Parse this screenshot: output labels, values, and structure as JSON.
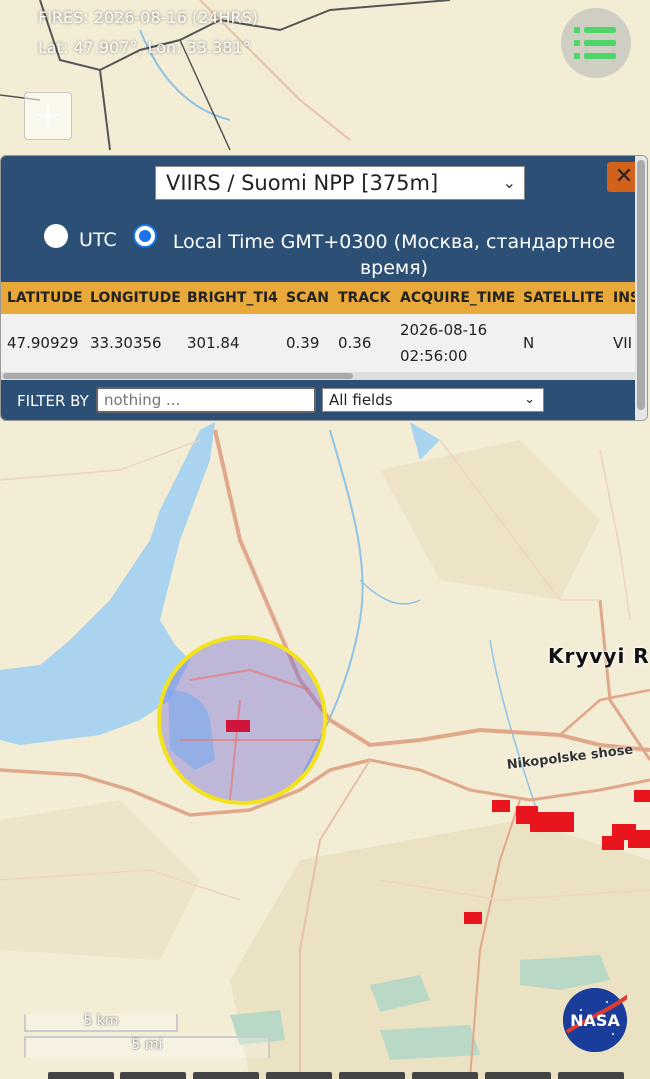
{
  "header": {
    "fires_title": "FIRES: 2026-08-16 (24HRS)",
    "coords": "Lat: 47.907°, Lon: 33.381°"
  },
  "zoom": {
    "plus": "+"
  },
  "panel": {
    "satellite_select": "VIIRS / Suomi NPP [375m]",
    "close": "✕",
    "time_options": {
      "utc": "UTC",
      "local": "Local Time GMT+0300 (Москва, стандартное время)",
      "selected": "local"
    },
    "table": {
      "columns": [
        "LATITUDE",
        "LONGITUDE",
        "BRIGHT_TI4",
        "SCAN",
        "TRACK",
        "ACQUIRE_TIME",
        "SATELLITE",
        "INS"
      ],
      "row": {
        "latitude": "47.90929",
        "longitude": "33.30356",
        "bright_ti4": "301.84",
        "scan": "0.39",
        "track": "0.36",
        "acquire_date": "2026-08-16",
        "acquire_clock": "02:56:00",
        "satellite": "N",
        "ins": "VII"
      }
    },
    "filter": {
      "label": "FILTER BY",
      "placeholder": "nothing ...",
      "field_select": "All fields"
    }
  },
  "map": {
    "city_label": "Kryvyi R",
    "road_label": "Nikopolske shose",
    "scale_km": "5 km",
    "scale_mi": "5 mi",
    "logo_text": "NASA",
    "colors": {
      "land": "#f3edd6",
      "water": "#a9d3ee",
      "fire": "#e8141e",
      "selection_circle": "#f2e31d",
      "panel_header": "#2c4f75",
      "table_header": "#e8a83a"
    }
  }
}
